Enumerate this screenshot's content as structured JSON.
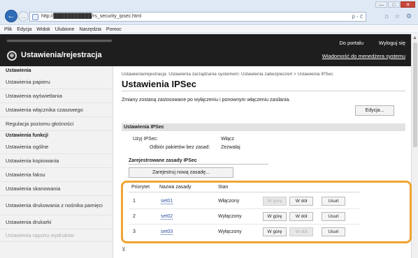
{
  "browser": {
    "url": "http://███████████/rs_security_ipsec.html",
    "address_tools": "ρ - ć",
    "tab_icons": "⌂ ☆ ⚙",
    "menu": [
      "Plik",
      "Edycja",
      "Widok",
      "Ulubione",
      "Narzędzia",
      "Pomoc"
    ]
  },
  "header": {
    "app_title": "Ustawienia/rejestracja",
    "portal_link": "Do portalu",
    "logout_link": "Wyloguj się",
    "message_link": "Wiadomość do menedżera systemu"
  },
  "sidebar": {
    "section1_title": "Ustawienia",
    "items1": [
      "Ustawienia papieru",
      "Ustawienia wyświetlania",
      "Ustawienia włącznika czasowego",
      "Regulacja poziomu głośności"
    ],
    "section2_title": "Ustawienia funkcji",
    "items2": [
      "Ustawienia ogólne",
      "Ustawienia kopiowania",
      "Ustawienia faksu",
      "Ustawienia skanowania",
      "Ustawienia drukowania z nośnika pamięci",
      "Ustawienia drukarki",
      "Ustawienia raportu wydruków"
    ]
  },
  "main": {
    "breadcrumb": "Ustawienia/rejestracja: Ustawienia zarządzania systemem: Ustawienia zabezpieczeń > Ustawienia IPSec",
    "title": "Ustawienia IPSec",
    "note": "Zmiany zostaną zastosowane po wyłączeniu i ponownym włączeniu zasilania.",
    "edit_button": "Edycja...",
    "section_title": "Ustawienia IPSec",
    "use_ipsec_label": "Użyj IPSec:",
    "use_ipsec_value": "Włącz",
    "no_policy_label": "Odbiór pakietów bez zasad:",
    "no_policy_value": "Zezwalaj",
    "registered_title": "Zarejestrowane zasady IPSec",
    "register_button": "Zarejestruj nową zasadę...",
    "table_headers": [
      "Priorytet",
      "Nazwa zasady",
      "Stan"
    ],
    "rows": [
      {
        "priority": "1",
        "name": "set01",
        "state": "Włączony",
        "up": "W górę",
        "down": "W dół",
        "delete": "Usuń",
        "up_enabled": false,
        "down_enabled": true
      },
      {
        "priority": "2",
        "name": "set02",
        "state": "Wyłączony",
        "up": "W górę",
        "down": "W dół",
        "delete": "Usuń",
        "up_enabled": true,
        "down_enabled": true
      },
      {
        "priority": "3",
        "name": "set03",
        "state": "Wyłączony",
        "up": "W górę",
        "down": "W dół",
        "delete": "Usuń",
        "up_enabled": true,
        "down_enabled": false
      }
    ]
  },
  "colors": {
    "highlight": "#f0a431",
    "header_bg": "#1e1e1e",
    "link": "#2b4fa3"
  }
}
